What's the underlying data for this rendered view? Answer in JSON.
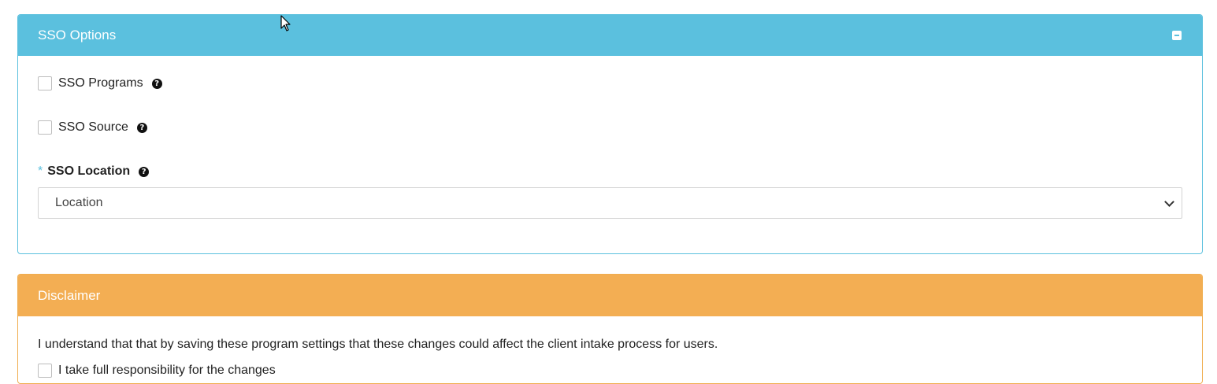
{
  "sso_panel": {
    "title": "SSO Options",
    "collapse_icon": "minus-square-icon",
    "programs_label": "SSO Programs",
    "source_label": "SSO Source",
    "location_required": "*",
    "location_label": "SSO Location",
    "location_select_value": "Location",
    "help_icon": "question-circle-icon"
  },
  "disclaimer_panel": {
    "title": "Disclaimer",
    "text": "I understand that that by saving these program settings that these changes could affect the client intake process for users.",
    "accept_label": "I take full responsibility for the changes"
  },
  "colors": {
    "info": "#5bc0de",
    "warning": "#f3ae53"
  }
}
